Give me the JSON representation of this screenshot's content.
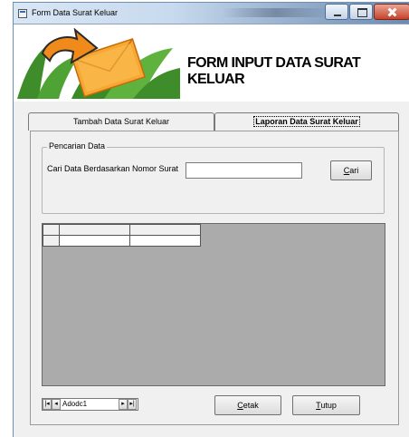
{
  "window": {
    "title": "Form Data Surat Keluar",
    "controls": {
      "minimize_icon": "minimize-icon",
      "maximize_icon": "maximize-icon",
      "close_icon": "close-icon"
    }
  },
  "header": {
    "title": "FORM INPUT DATA SURAT KELUAR",
    "logo_icon": "mail-envelope-arrow-logo"
  },
  "tabs": [
    {
      "label": "Tambah Data Surat Keluar",
      "active": false
    },
    {
      "label": "Laporan Data Surat Keluar",
      "active": true
    }
  ],
  "search": {
    "group_label": "Pencarian Data",
    "field_label": "Cari Data Berdasarkan Nomor Surat",
    "value": "",
    "button_label": "Cari",
    "button_hotkey": "C",
    "button_rest": "ari"
  },
  "grid": {
    "columns": [
      "",
      ""
    ],
    "rows": [
      [
        "",
        ""
      ]
    ]
  },
  "adodc": {
    "caption": "Adodc1"
  },
  "actions": {
    "cetak_hotkey": "C",
    "cetak_rest": "etak",
    "tutup_hotkey": "T",
    "tutup_rest": "utup"
  },
  "colors": {
    "titlebar_light": "#d9e6f4",
    "titlebar_dark": "#6d8bb0",
    "close_button": "#c7422a",
    "face": "#f0f0f0",
    "grid_background": "#ababab",
    "logo_green": "#3f8d2a",
    "logo_orange": "#f08a1a"
  }
}
